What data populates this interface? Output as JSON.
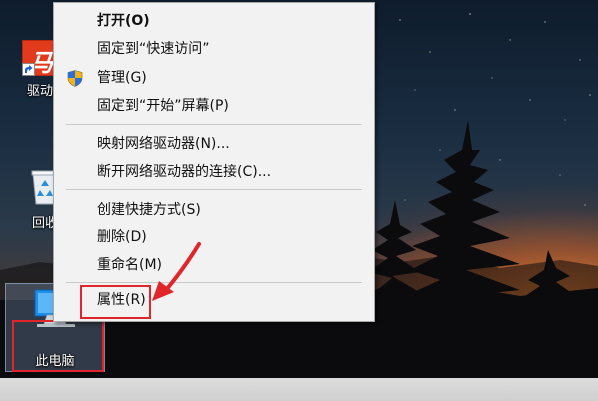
{
  "desktop": {
    "icons": [
      {
        "label": "驱动精灵",
        "visible_label": "驱动",
        "icon": "app-shortcut-icon"
      },
      {
        "label": "回收站",
        "visible_label": "回收",
        "icon": "recycle-bin-icon"
      },
      {
        "label": "此电脑",
        "icon": "this-pc-icon"
      }
    ],
    "app_glyph": "马"
  },
  "context_menu": {
    "items": [
      {
        "label": "打开(O)",
        "bold": true
      },
      {
        "label": "固定到“快速访问”"
      },
      {
        "label": "管理(G)",
        "icon": "uac-shield-icon"
      },
      {
        "label": "固定到“开始”屏幕(P)"
      },
      {
        "label": "映射网络驱动器(N)..."
      },
      {
        "label": "断开网络驱动器的连接(C)..."
      },
      {
        "label": "创建快捷方式(S)"
      },
      {
        "label": "删除(D)"
      },
      {
        "label": "重命名(M)"
      },
      {
        "label": "属性(R)",
        "highlighted": true
      }
    ]
  },
  "annotation": {
    "color": "#e0252b",
    "arrow_icon": "red-arrow-icon"
  }
}
